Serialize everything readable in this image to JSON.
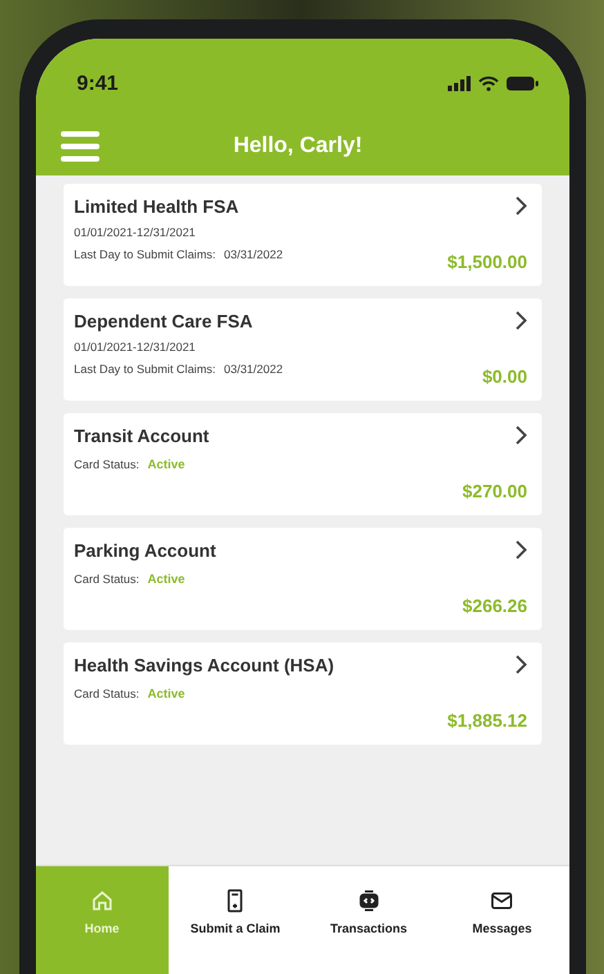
{
  "status_bar": {
    "time": "9:41"
  },
  "header": {
    "title": "Hello, Carly!"
  },
  "accounts": [
    {
      "kind": "fsa",
      "name": "Limited Health FSA",
      "dates": "01/01/2021-12/31/2021",
      "deadline_label": "Last Day to Submit Claims:",
      "deadline": "03/31/2022",
      "amount": "$1,500.00"
    },
    {
      "kind": "fsa",
      "name": "Dependent Care FSA",
      "dates": "01/01/2021-12/31/2021",
      "deadline_label": "Last Day to Submit Claims:",
      "deadline": "03/31/2022",
      "amount": "$0.00"
    },
    {
      "kind": "card",
      "name": "Transit Account",
      "status_label": "Card Status:",
      "status": "Active",
      "amount": "$270.00"
    },
    {
      "kind": "card",
      "name": "Parking Account",
      "status_label": "Card Status:",
      "status": "Active",
      "amount": "$266.26"
    },
    {
      "kind": "card",
      "name": "Health Savings Account (HSA)",
      "status_label": "Card Status:",
      "status": "Active",
      "amount": "$1,885.12"
    }
  ],
  "tab_bar": [
    {
      "kind": "home",
      "label": "Home",
      "selected": true
    },
    {
      "kind": "claim",
      "label": "Submit a Claim",
      "selected": false
    },
    {
      "kind": "transactions",
      "label": "Transactions",
      "selected": false
    },
    {
      "kind": "messages",
      "label": "Messages",
      "selected": false
    }
  ]
}
